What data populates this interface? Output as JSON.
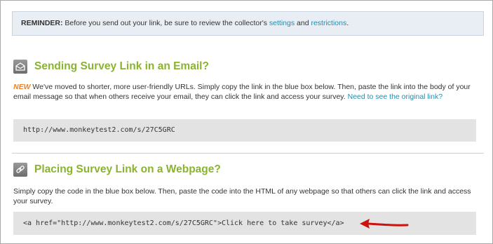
{
  "reminder": {
    "label": "REMINDER:",
    "text": " Before you send out your link, be sure to review the collector's ",
    "settings_link": "settings",
    "and": " and ",
    "restrictions_link": "restrictions",
    "end": "."
  },
  "email_section": {
    "icon": "envelope-icon",
    "title": "Sending Survey Link in an Email?",
    "new_tag": "NEW",
    "description": " We've moved to shorter, more user-friendly URLs. Simply copy the link in the blue box below. Then, paste the link into the body of your email message so that when others receive your email, they can click the link and access your survey. ",
    "original_link": "Need to see the original link?",
    "survey_url": "http://www.monkeytest2.com/s/27C5GRC"
  },
  "webpage_section": {
    "icon": "chain-link-icon",
    "title": "Placing Survey Link on a Webpage?",
    "description": "Simply copy the code in the blue box below. Then, paste the code into the HTML of any webpage so that others can click the link and access your survey.",
    "embed_code": "<a href=\"http://www.monkeytest2.com/s/27C5GRC\">Click here to take survey</a>"
  },
  "colors": {
    "section_title": "#8ab32e",
    "link": "#1a8fb3",
    "new_tag": "#f58220",
    "arrow": "#cc1111",
    "code_box": "#e3e3e3",
    "reminder_box": "#e9eef4"
  }
}
